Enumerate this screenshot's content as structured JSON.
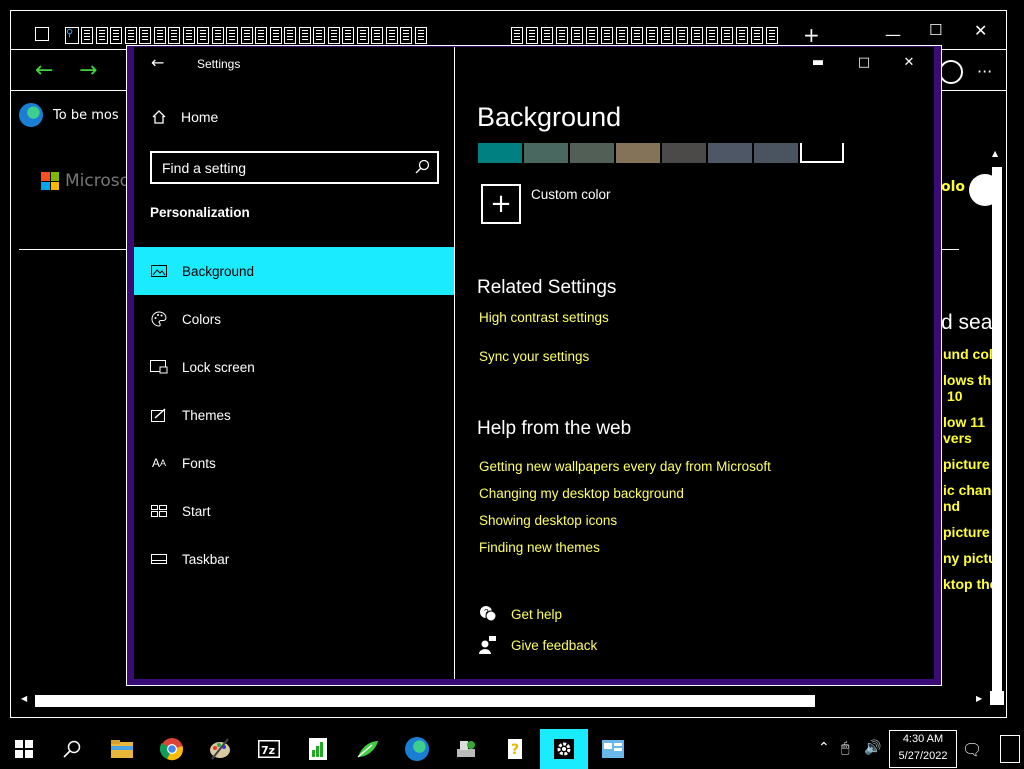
{
  "browser": {
    "notice_text": "To be mos",
    "ms_logo_text": "Microsoft",
    "right_user_text": "olo",
    "right_heading": "d sea",
    "right_links": [
      "und colo",
      "lows th",
      "10",
      "low 11",
      "vers",
      "picture c",
      "ic chang",
      "nd",
      "picture c",
      "ny pictu",
      "ktop the"
    ],
    "tab_new": "+",
    "menu": "···"
  },
  "settings": {
    "title": "Settings",
    "home_label": "Home",
    "search_placeholder": "Find a setting",
    "section_heading": "Personalization",
    "nav": [
      {
        "label": "Background",
        "icon": "picture-icon",
        "selected": true
      },
      {
        "label": "Colors",
        "icon": "palette-icon",
        "selected": false
      },
      {
        "label": "Lock screen",
        "icon": "lock-screen-icon",
        "selected": false
      },
      {
        "label": "Themes",
        "icon": "themes-icon",
        "selected": false
      },
      {
        "label": "Fonts",
        "icon": "fonts-icon",
        "selected": false
      },
      {
        "label": "Start",
        "icon": "start-icon",
        "selected": false
      },
      {
        "label": "Taskbar",
        "icon": "taskbar-icon",
        "selected": false
      }
    ],
    "page_title": "Background",
    "swatch_colors": [
      "#008080",
      "#486860",
      "#525f57",
      "#847358",
      "#4c4a48",
      "#4d5765",
      "#4a5460"
    ],
    "custom_color_label": "Custom color",
    "related_heading": "Related Settings",
    "related_links": [
      "High contrast settings",
      "Sync your settings"
    ],
    "help_heading": "Help from the web",
    "help_links": [
      "Getting new wallpapers every day from Microsoft",
      "Changing my desktop background",
      "Showing desktop icons",
      "Finding new themes"
    ],
    "get_help": "Get help",
    "give_feedback": "Give feedback"
  },
  "taskbar": {
    "time": "4:30 AM",
    "date": "5/27/2022",
    "active_app": "settings"
  },
  "colors": {
    "accent_highlight": "#1aebff",
    "link_yellow": "#ffff66",
    "window_border": "#3a0a77",
    "nav_arrow_green": "#3fd43f"
  }
}
